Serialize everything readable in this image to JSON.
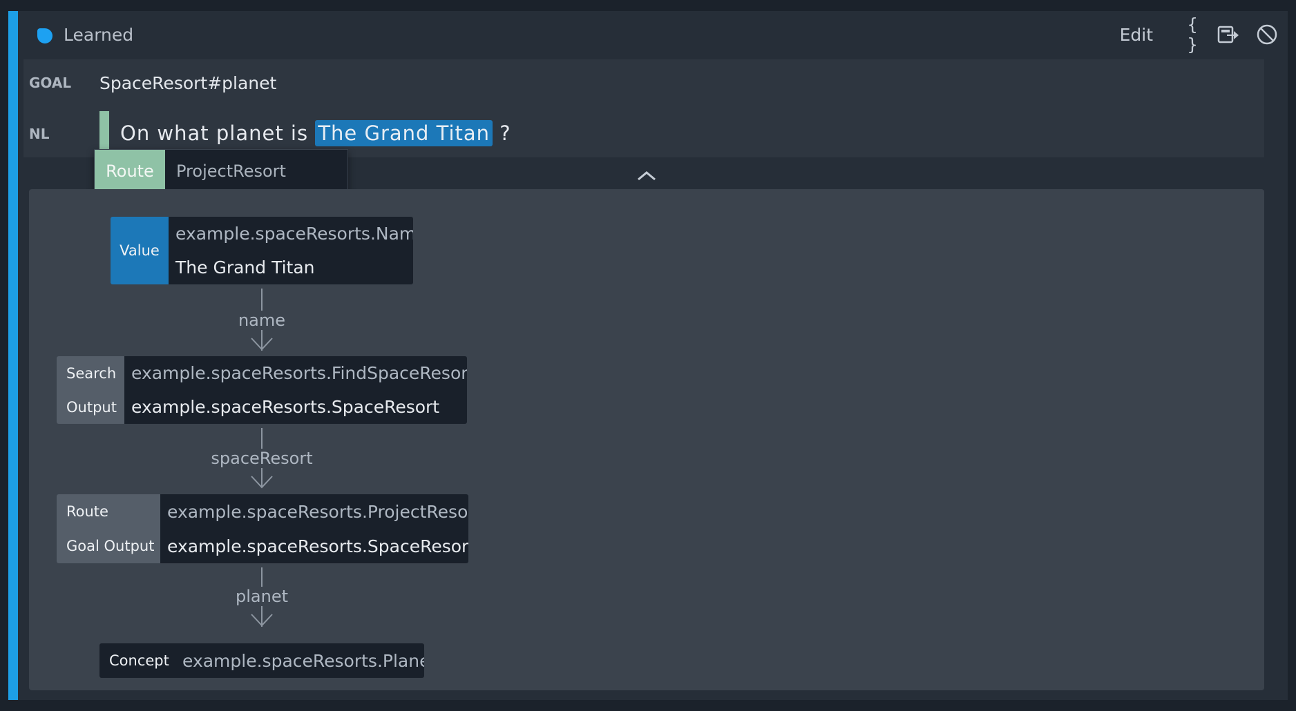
{
  "header": {
    "status": "Learned",
    "toolbar": {
      "edit_label": "Edit",
      "json_label": "{ }",
      "export_icon": "export-icon",
      "disable_icon": "disable-icon",
      "delete_icon": "trash-icon"
    }
  },
  "info": {
    "goal_label": "GOAL",
    "goal_value": "SpaceResort#planet",
    "nl_label": "NL",
    "nl_text_before": "On what planet is",
    "nl_highlight": "The Grand Titan",
    "nl_text_after": "?"
  },
  "route_popup": {
    "tag": "Route",
    "value": "ProjectResort"
  },
  "graph": {
    "value_node": {
      "tag": "Value",
      "type": "example.spaceResorts.Name",
      "value": "The Grand Titan"
    },
    "edge1": "name",
    "search_node": {
      "tag1": "Search",
      "tag2": "Output",
      "type": "example.spaceResorts.FindSpaceResorts",
      "value": "example.spaceResorts.SpaceResort"
    },
    "edge2": "spaceResort",
    "route_node": {
      "tag1": "Route",
      "tag2": "Goal Output",
      "type": "example.spaceResorts.ProjectResort",
      "value": "example.spaceResorts.SpaceResort"
    },
    "edge3": "planet",
    "concept_node": {
      "tag": "Concept",
      "type": "example.spaceResorts.Planet"
    }
  },
  "colors": {
    "accent": "#1d9fe6",
    "route": "#8fc2a6",
    "value_tag": "#1c78b8"
  }
}
